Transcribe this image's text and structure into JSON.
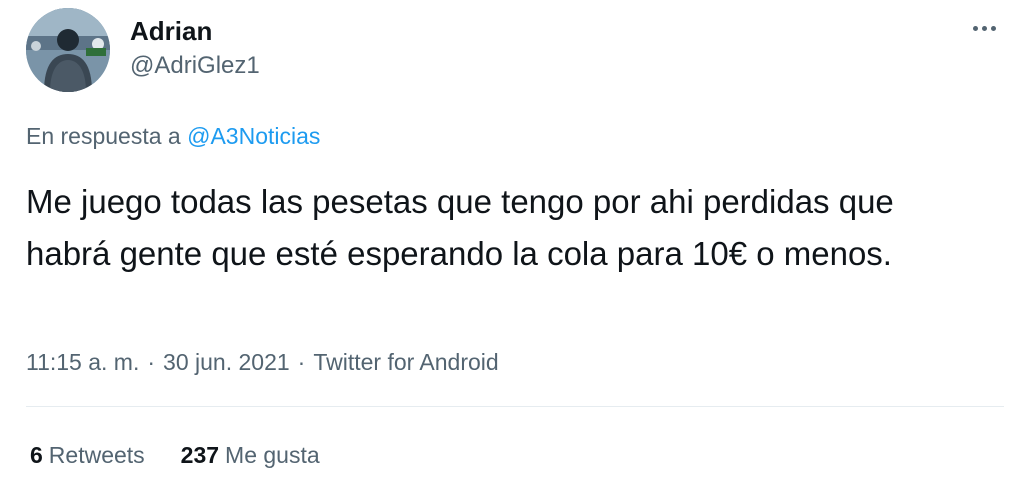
{
  "tweet": {
    "author": {
      "display_name": "Adrian",
      "handle": "@AdriGlez1",
      "avatar_icon": "user-avatar"
    },
    "more_icon": "more-horizontal-icon",
    "reply_prefix": "En respuesta a",
    "reply_to": "@A3Noticias",
    "text": "Me juego todas las pesetas que tengo por ahi perdidas que habrá gente que esté esperando la cola para 10€ o menos.",
    "time": "11:15 a. m.",
    "date": "30 jun. 2021",
    "source": "Twitter for Android",
    "separator": "·",
    "stats": {
      "retweets_count": "6",
      "retweets_label": "Retweets",
      "likes_count": "237",
      "likes_label": "Me gusta"
    },
    "colors": {
      "link": "#1d9bf0",
      "secondary_text": "#536471",
      "primary_text": "#0f1419"
    }
  }
}
